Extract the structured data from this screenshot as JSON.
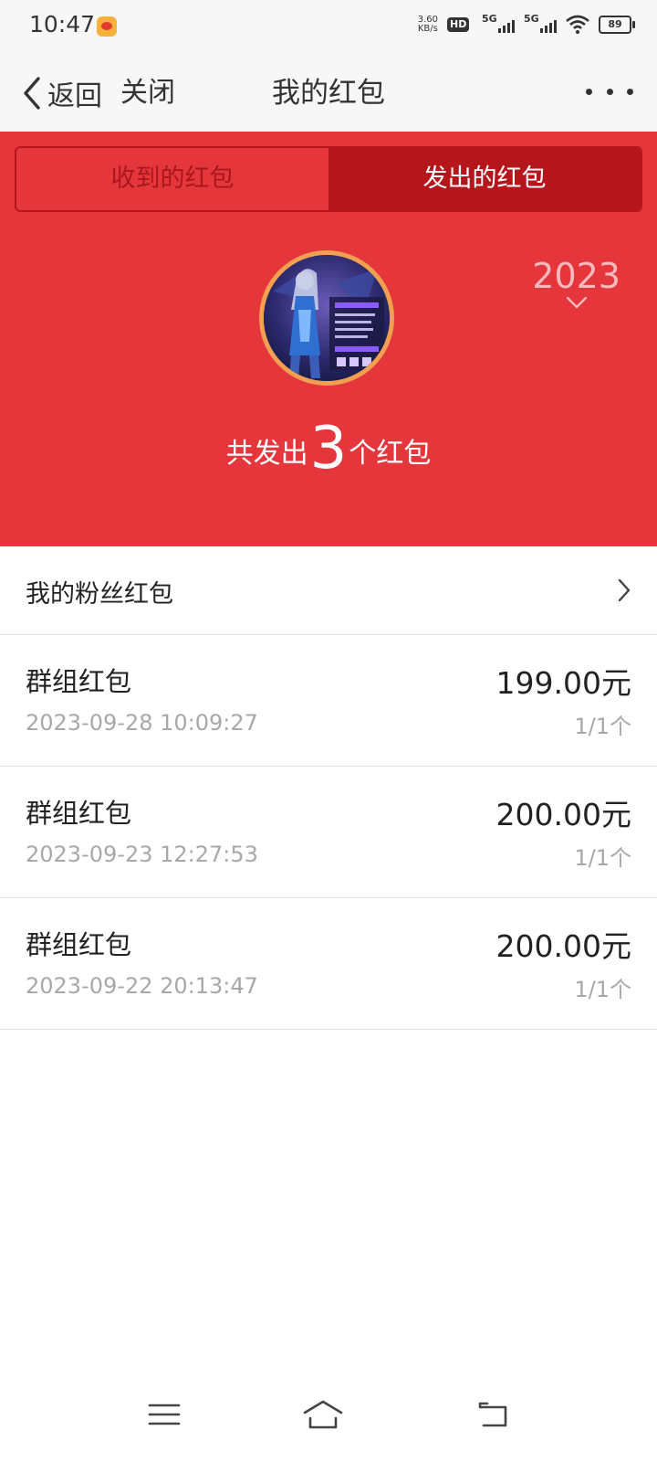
{
  "status": {
    "time": "10:47",
    "net_speed_value": "3.60",
    "net_speed_unit": "KB/s",
    "hd_label": "HD",
    "sim1_label": "5G",
    "sim2_label": "5G",
    "battery": "89"
  },
  "nav": {
    "back_label": "返回",
    "close_label": "关闭",
    "title": "我的红包"
  },
  "tabs": [
    {
      "label": "收到的红包",
      "active": false
    },
    {
      "label": "发出的红包",
      "active": true
    }
  ],
  "hero": {
    "year": "2023",
    "summary_prefix": "共发出",
    "summary_count": "3",
    "summary_suffix": "个红包"
  },
  "fan_packets": {
    "label": "我的粉丝红包"
  },
  "packets": [
    {
      "name": "群组红包",
      "time": "2023-09-28 10:09:27",
      "amount": "199.00元",
      "count": "1/1个"
    },
    {
      "name": "群组红包",
      "time": "2023-09-23 12:27:53",
      "amount": "200.00元",
      "count": "1/1个"
    },
    {
      "name": "群组红包",
      "time": "2023-09-22 20:13:47",
      "amount": "200.00元",
      "count": "1/1个"
    }
  ],
  "colors": {
    "primary_red": "#e5363c",
    "dark_red": "#b5161b",
    "avatar_border": "#f0a050"
  }
}
